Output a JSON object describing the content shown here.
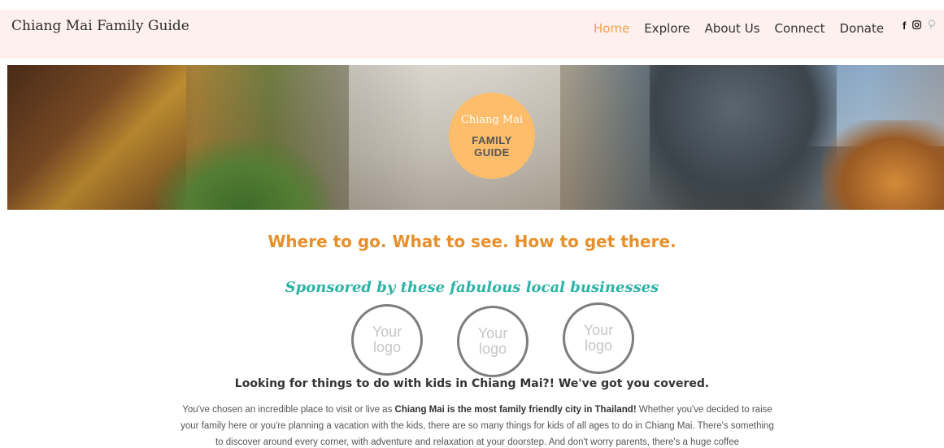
{
  "site": {
    "title": "Chiang Mai Family Guide"
  },
  "nav": {
    "items": [
      "Home",
      "Explore",
      "About Us",
      "Connect",
      "Donate"
    ],
    "active": "Home"
  },
  "social": {
    "icons": [
      "facebook-icon",
      "instagram-icon",
      "pinterest-icon"
    ]
  },
  "hero": {
    "badge_script": "Chiang Mai",
    "badge_line1": "FAMILY",
    "badge_line2": "GUIDE"
  },
  "main": {
    "tagline": "Where to go. What to see. How to get there.",
    "sponsored": "Sponsored by these fabulous local businesses",
    "logo_placeholder": {
      "line1": "Your",
      "line2": "logo"
    },
    "heading": "Looking for things to do with kids in Chiang Mai?! We've got you covered.",
    "body_intro": "You've chosen an incredible place to visit or live as ",
    "body_bold": "Chiang Mai is the most family friendly city in Thailand!",
    "body_rest": " Whether you've decided to raise your family here or you're planning a vacation with the kids, there are so many things for kids of all ages to do in Chiang Mai. There's something to discover around every corner, with adventure and relaxation at your doorstep. And don't worry parents, there's a huge coffee"
  },
  "colors": {
    "accent_orange": "#f4a24a",
    "tagline_orange": "#e6902c",
    "teal": "#2bb3a6",
    "header_bg": "#fdf0ef",
    "badge": "#fdbd6a"
  }
}
